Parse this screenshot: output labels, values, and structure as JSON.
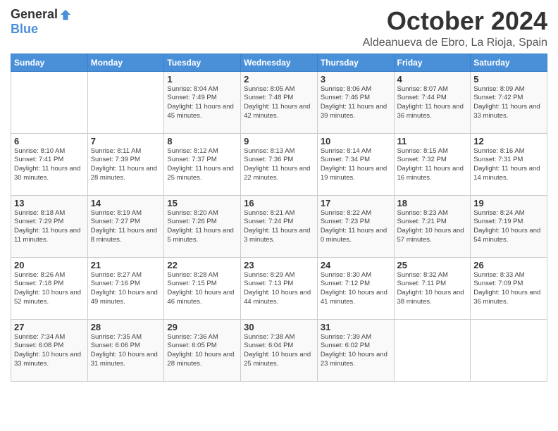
{
  "logo": {
    "general": "General",
    "blue": "Blue"
  },
  "header": {
    "month": "October 2024",
    "location": "Aldeanueva de Ebro, La Rioja, Spain"
  },
  "days_of_week": [
    "Sunday",
    "Monday",
    "Tuesday",
    "Wednesday",
    "Thursday",
    "Friday",
    "Saturday"
  ],
  "weeks": [
    [
      {
        "day": "",
        "sunrise": "",
        "sunset": "",
        "daylight": ""
      },
      {
        "day": "",
        "sunrise": "",
        "sunset": "",
        "daylight": ""
      },
      {
        "day": "1",
        "sunrise": "Sunrise: 8:04 AM",
        "sunset": "Sunset: 7:49 PM",
        "daylight": "Daylight: 11 hours and 45 minutes."
      },
      {
        "day": "2",
        "sunrise": "Sunrise: 8:05 AM",
        "sunset": "Sunset: 7:48 PM",
        "daylight": "Daylight: 11 hours and 42 minutes."
      },
      {
        "day": "3",
        "sunrise": "Sunrise: 8:06 AM",
        "sunset": "Sunset: 7:46 PM",
        "daylight": "Daylight: 11 hours and 39 minutes."
      },
      {
        "day": "4",
        "sunrise": "Sunrise: 8:07 AM",
        "sunset": "Sunset: 7:44 PM",
        "daylight": "Daylight: 11 hours and 36 minutes."
      },
      {
        "day": "5",
        "sunrise": "Sunrise: 8:09 AM",
        "sunset": "Sunset: 7:42 PM",
        "daylight": "Daylight: 11 hours and 33 minutes."
      }
    ],
    [
      {
        "day": "6",
        "sunrise": "Sunrise: 8:10 AM",
        "sunset": "Sunset: 7:41 PM",
        "daylight": "Daylight: 11 hours and 30 minutes."
      },
      {
        "day": "7",
        "sunrise": "Sunrise: 8:11 AM",
        "sunset": "Sunset: 7:39 PM",
        "daylight": "Daylight: 11 hours and 28 minutes."
      },
      {
        "day": "8",
        "sunrise": "Sunrise: 8:12 AM",
        "sunset": "Sunset: 7:37 PM",
        "daylight": "Daylight: 11 hours and 25 minutes."
      },
      {
        "day": "9",
        "sunrise": "Sunrise: 8:13 AM",
        "sunset": "Sunset: 7:36 PM",
        "daylight": "Daylight: 11 hours and 22 minutes."
      },
      {
        "day": "10",
        "sunrise": "Sunrise: 8:14 AM",
        "sunset": "Sunset: 7:34 PM",
        "daylight": "Daylight: 11 hours and 19 minutes."
      },
      {
        "day": "11",
        "sunrise": "Sunrise: 8:15 AM",
        "sunset": "Sunset: 7:32 PM",
        "daylight": "Daylight: 11 hours and 16 minutes."
      },
      {
        "day": "12",
        "sunrise": "Sunrise: 8:16 AM",
        "sunset": "Sunset: 7:31 PM",
        "daylight": "Daylight: 11 hours and 14 minutes."
      }
    ],
    [
      {
        "day": "13",
        "sunrise": "Sunrise: 8:18 AM",
        "sunset": "Sunset: 7:29 PM",
        "daylight": "Daylight: 11 hours and 11 minutes."
      },
      {
        "day": "14",
        "sunrise": "Sunrise: 8:19 AM",
        "sunset": "Sunset: 7:27 PM",
        "daylight": "Daylight: 11 hours and 8 minutes."
      },
      {
        "day": "15",
        "sunrise": "Sunrise: 8:20 AM",
        "sunset": "Sunset: 7:26 PM",
        "daylight": "Daylight: 11 hours and 5 minutes."
      },
      {
        "day": "16",
        "sunrise": "Sunrise: 8:21 AM",
        "sunset": "Sunset: 7:24 PM",
        "daylight": "Daylight: 11 hours and 3 minutes."
      },
      {
        "day": "17",
        "sunrise": "Sunrise: 8:22 AM",
        "sunset": "Sunset: 7:23 PM",
        "daylight": "Daylight: 11 hours and 0 minutes."
      },
      {
        "day": "18",
        "sunrise": "Sunrise: 8:23 AM",
        "sunset": "Sunset: 7:21 PM",
        "daylight": "Daylight: 10 hours and 57 minutes."
      },
      {
        "day": "19",
        "sunrise": "Sunrise: 8:24 AM",
        "sunset": "Sunset: 7:19 PM",
        "daylight": "Daylight: 10 hours and 54 minutes."
      }
    ],
    [
      {
        "day": "20",
        "sunrise": "Sunrise: 8:26 AM",
        "sunset": "Sunset: 7:18 PM",
        "daylight": "Daylight: 10 hours and 52 minutes."
      },
      {
        "day": "21",
        "sunrise": "Sunrise: 8:27 AM",
        "sunset": "Sunset: 7:16 PM",
        "daylight": "Daylight: 10 hours and 49 minutes."
      },
      {
        "day": "22",
        "sunrise": "Sunrise: 8:28 AM",
        "sunset": "Sunset: 7:15 PM",
        "daylight": "Daylight: 10 hours and 46 minutes."
      },
      {
        "day": "23",
        "sunrise": "Sunrise: 8:29 AM",
        "sunset": "Sunset: 7:13 PM",
        "daylight": "Daylight: 10 hours and 44 minutes."
      },
      {
        "day": "24",
        "sunrise": "Sunrise: 8:30 AM",
        "sunset": "Sunset: 7:12 PM",
        "daylight": "Daylight: 10 hours and 41 minutes."
      },
      {
        "day": "25",
        "sunrise": "Sunrise: 8:32 AM",
        "sunset": "Sunset: 7:11 PM",
        "daylight": "Daylight: 10 hours and 38 minutes."
      },
      {
        "day": "26",
        "sunrise": "Sunrise: 8:33 AM",
        "sunset": "Sunset: 7:09 PM",
        "daylight": "Daylight: 10 hours and 36 minutes."
      }
    ],
    [
      {
        "day": "27",
        "sunrise": "Sunrise: 7:34 AM",
        "sunset": "Sunset: 6:08 PM",
        "daylight": "Daylight: 10 hours and 33 minutes."
      },
      {
        "day": "28",
        "sunrise": "Sunrise: 7:35 AM",
        "sunset": "Sunset: 6:06 PM",
        "daylight": "Daylight: 10 hours and 31 minutes."
      },
      {
        "day": "29",
        "sunrise": "Sunrise: 7:36 AM",
        "sunset": "Sunset: 6:05 PM",
        "daylight": "Daylight: 10 hours and 28 minutes."
      },
      {
        "day": "30",
        "sunrise": "Sunrise: 7:38 AM",
        "sunset": "Sunset: 6:04 PM",
        "daylight": "Daylight: 10 hours and 25 minutes."
      },
      {
        "day": "31",
        "sunrise": "Sunrise: 7:39 AM",
        "sunset": "Sunset: 6:02 PM",
        "daylight": "Daylight: 10 hours and 23 minutes."
      },
      {
        "day": "",
        "sunrise": "",
        "sunset": "",
        "daylight": ""
      },
      {
        "day": "",
        "sunrise": "",
        "sunset": "",
        "daylight": ""
      }
    ]
  ]
}
